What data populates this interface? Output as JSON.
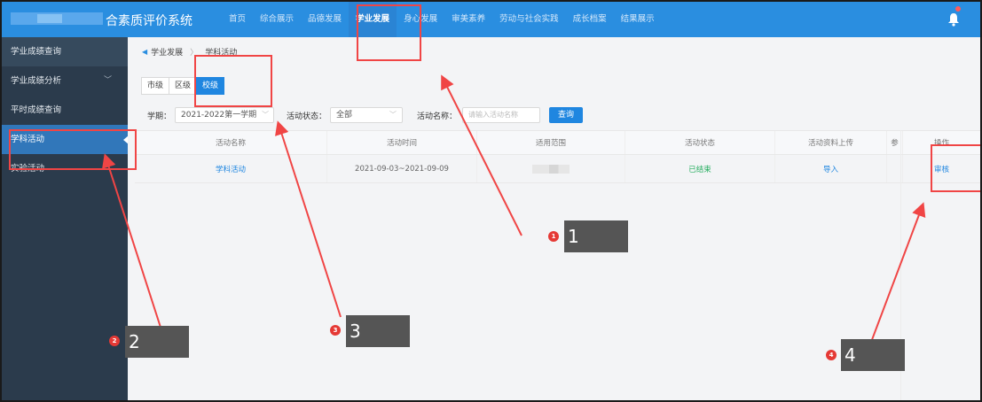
{
  "header": {
    "app_title": "合素质评价系统",
    "nav": [
      {
        "label": "首页",
        "active": false
      },
      {
        "label": "综合展示",
        "active": false
      },
      {
        "label": "品德发展",
        "active": false
      },
      {
        "label": "学业发展",
        "active": true
      },
      {
        "label": "身心发展",
        "active": false
      },
      {
        "label": "审美素养",
        "active": false
      },
      {
        "label": "劳动与社会实践",
        "active": false
      },
      {
        "label": "成长档案",
        "active": false
      },
      {
        "label": "结果展示",
        "active": false
      }
    ]
  },
  "sidebar": {
    "items": [
      {
        "label": "学业成绩查询",
        "active": false
      },
      {
        "label": "学业成绩分析",
        "active": false,
        "chevron": "﹀"
      },
      {
        "label": "平时成绩查询",
        "active": false
      },
      {
        "label": "学科活动",
        "active": true
      },
      {
        "label": "实验活动",
        "active": false
      }
    ]
  },
  "breadcrumb": {
    "parent": "学业发展",
    "current": "学科活动"
  },
  "level_tabs": [
    {
      "label": "市级",
      "active": false
    },
    {
      "label": "区级",
      "active": false
    },
    {
      "label": "校级",
      "active": true
    }
  ],
  "filters": {
    "term_label": "学期：",
    "term_value": "2021-2022第一学期",
    "status_label": "活动状态：",
    "status_value": "全部",
    "name_label": "活动名称：",
    "name_placeholder": "请输入活动名称",
    "query_button": "查询"
  },
  "table": {
    "headers": [
      "活动名称",
      "活动时间",
      "适用范围",
      "活动状态",
      "活动资料上传",
      "参",
      "操作"
    ],
    "rows": [
      {
        "name": "学科活动",
        "time": "2021-09-03~2021-09-09",
        "status": "已结束",
        "upload": "导入",
        "action": "审核"
      }
    ]
  },
  "annotations": {
    "labels": [
      "1",
      "2",
      "3",
      "4"
    ],
    "dot_labels": [
      "1",
      "2",
      "3",
      "4"
    ],
    "color": "#f04545"
  },
  "colors": {
    "topbar": "#2a8ee0",
    "sidebar": "#2b3b4c",
    "sidebar_active": "#3177ba",
    "primary": "#1f86e0",
    "success": "#27ae60"
  }
}
